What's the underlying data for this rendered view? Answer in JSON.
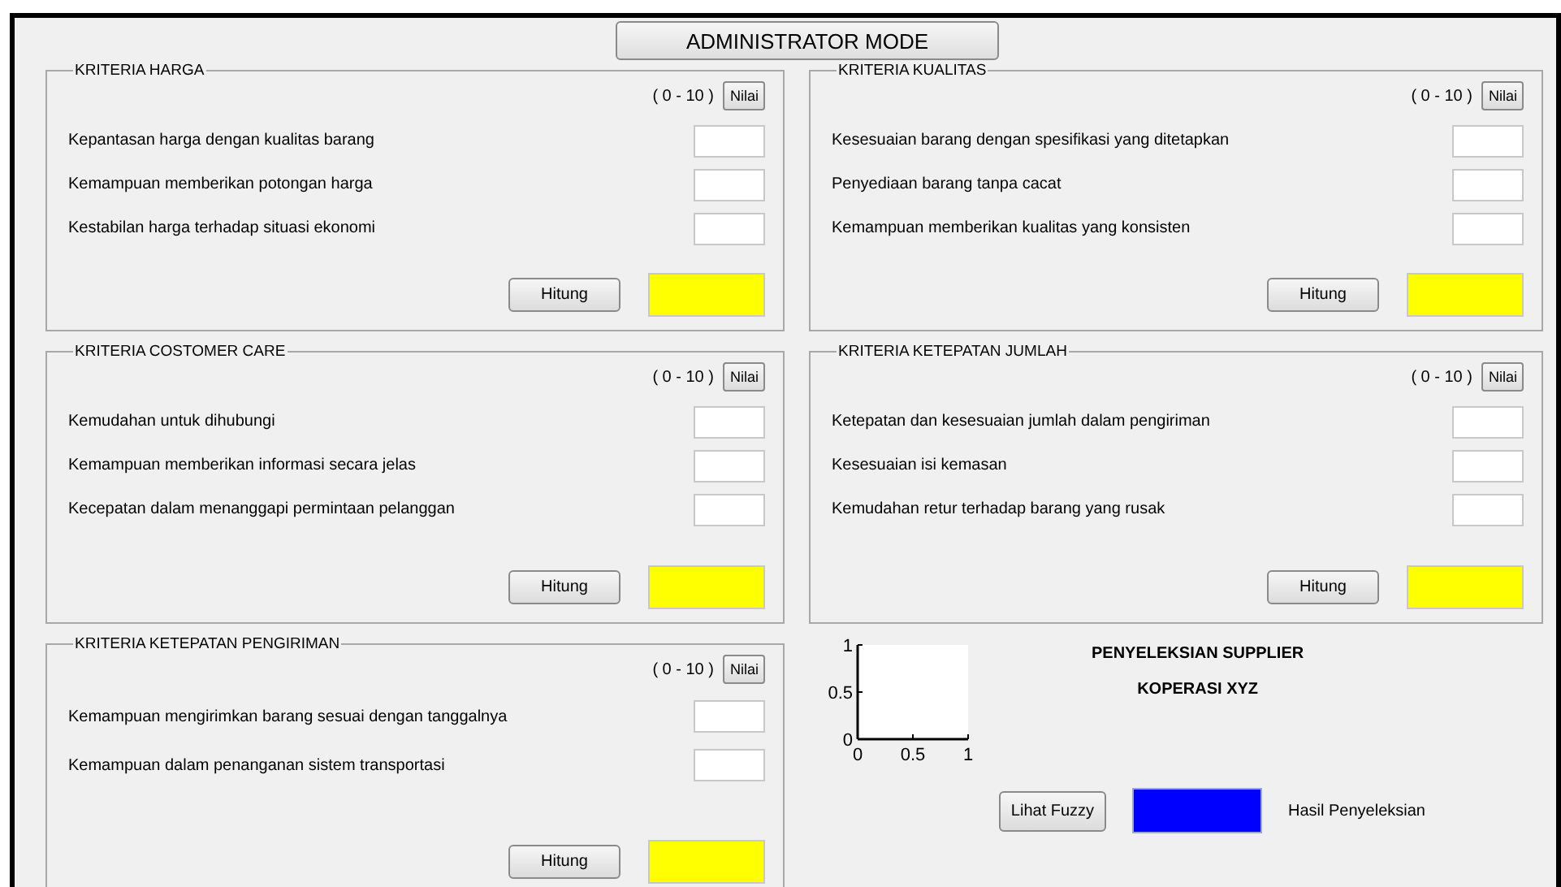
{
  "mode_button": "ADMINISTRATOR MODE",
  "panels": [
    {
      "title": "KRITERIA HARGA",
      "range": "( 0 - 10 )",
      "nilai_button": "Nilai",
      "criteria": [
        {
          "label": "Kepantasan harga dengan kualitas barang"
        },
        {
          "label": "Kemampuan memberikan potongan harga"
        },
        {
          "label": "Kestabilan harga terhadap situasi ekonomi"
        }
      ],
      "hitung_button": "Hitung"
    },
    {
      "title": "KRITERIA KUALITAS",
      "range": "( 0 - 10 )",
      "nilai_button": "Nilai",
      "criteria": [
        {
          "label": "Kesesuaian barang dengan spesifikasi yang ditetapkan"
        },
        {
          "label": "Penyediaan barang tanpa cacat"
        },
        {
          "label": "Kemampuan memberikan kualitas yang konsisten"
        }
      ],
      "hitung_button": "Hitung"
    },
    {
      "title": "KRITERIA COSTOMER CARE",
      "range": "( 0 - 10 )",
      "nilai_button": "Nilai",
      "criteria": [
        {
          "label": "Kemudahan untuk dihubungi"
        },
        {
          "label": "Kemampuan memberikan informasi secara jelas"
        },
        {
          "label": "Kecepatan dalam menanggapi permintaan pelanggan"
        }
      ],
      "hitung_button": "Hitung"
    },
    {
      "title": "KRITERIA KETEPATAN JUMLAH",
      "range": "( 0 - 10 )",
      "nilai_button": "Nilai",
      "criteria": [
        {
          "label": "Ketepatan dan kesesuaian jumlah dalam pengiriman"
        },
        {
          "label": "Kesesuaian isi kemasan"
        },
        {
          "label": "Kemudahan retur terhadap barang yang rusak"
        }
      ],
      "hitung_button": "Hitung"
    },
    {
      "title": "KRITERIA KETEPATAN PENGIRIMAN",
      "range": "( 0 - 10 )",
      "nilai_button": "Nilai",
      "criteria": [
        {
          "label": "Kemampuan mengirimkan barang sesuai dengan tanggalnya"
        },
        {
          "label": "Kemampuan dalam penanganan sistem transportasi"
        }
      ],
      "hitung_button": "Hitung"
    }
  ],
  "summary": {
    "chart_data": {
      "type": "line",
      "xlim": [
        0,
        1
      ],
      "ylim": [
        0,
        1
      ],
      "xticks": [
        0,
        0.5,
        1
      ],
      "yticks": [
        0,
        0.5,
        1
      ]
    },
    "title": "PENYELEKSIAN SUPPLIER",
    "subtitle": "KOPERASI XYZ",
    "fuzzy_button": "Lihat Fuzzy",
    "result_label": "Hasil Penyeleksian"
  }
}
